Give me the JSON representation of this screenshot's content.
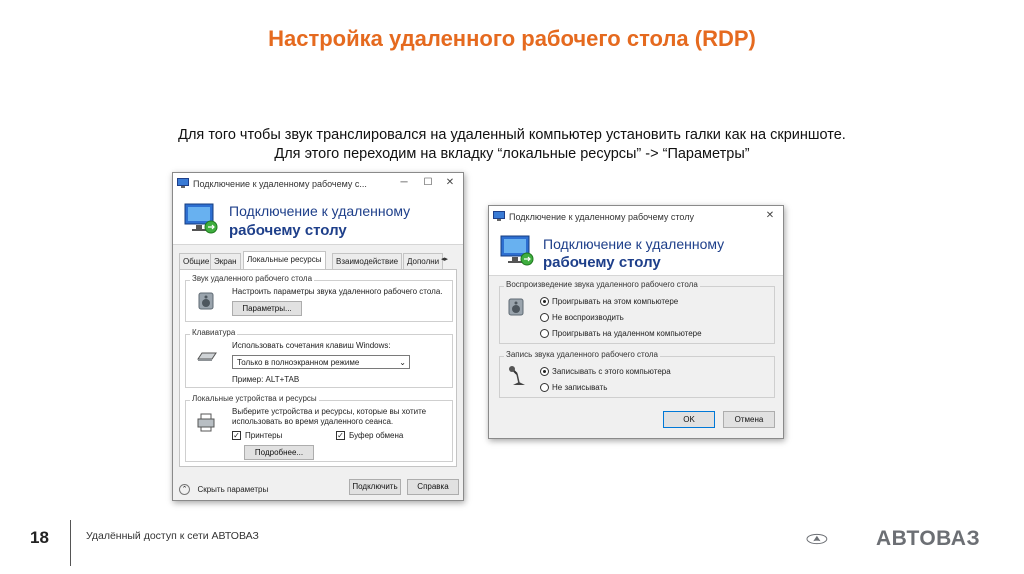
{
  "slide": {
    "title": "Настройка удаленного рабочего стола (RDP)",
    "description_line1": "Для того чтобы звук транслировался на удаленный компьютер установить галки как на скриншоте.",
    "description_line2": "Для этого переходим на вкладку “локальные ресурсы” -> “Параметры”"
  },
  "left_window": {
    "title": "Подключение к удаленному рабочему с...",
    "header_line1": "Подключение к удаленному",
    "header_line2": "рабочему столу",
    "tabs": [
      "Общие",
      "Экран",
      "Локальные ресурсы",
      "Взаимодействие",
      "Дополни"
    ],
    "active_tab": "Локальные ресурсы",
    "audio_group": {
      "title": "Звук удаленного рабочего стола",
      "text": "Настроить параметры звука удаленного рабочего стола.",
      "button": "Параметры..."
    },
    "keyboard_group": {
      "title": "Клавиатура",
      "text": "Использовать сочетания клавиш Windows:",
      "select_value": "Только в полноэкранном режиме",
      "example": "Пример: ALT+TAB"
    },
    "devices_group": {
      "title": "Локальные устройства и ресурсы",
      "text_line1": "Выберите устройства и ресурсы, которые вы хотите",
      "text_line2": "использовать во время удаленного сеанса.",
      "printers_label": "Принтеры",
      "printers_checked": true,
      "clipboard_label": "Буфер обмена",
      "clipboard_checked": true,
      "more_button": "Подробнее..."
    },
    "hide_options": "Скрыть параметры",
    "connect_button": "Подключить",
    "help_button": "Справка"
  },
  "right_window": {
    "title": "Подключение к удаленному рабочему столу",
    "header_line1": "Подключение к удаленному",
    "header_line2": "рабочему столу",
    "playback_group": {
      "title": "Воспроизведение звука удаленного рабочего стола",
      "options": [
        "Проигрывать на этом компьютере",
        "Не воспроизводить",
        "Проигрывать на удаленном компьютере"
      ],
      "selected_index": 0
    },
    "record_group": {
      "title": "Запись звука удаленного рабочего стола",
      "options": [
        "Записывать с этого компьютера",
        "Не записывать"
      ],
      "selected_index": 0
    },
    "ok_button": "OK",
    "cancel_button": "Отмена"
  },
  "footer": {
    "page_number": "18",
    "text": "Удалённый доступ к сети АВТОВАЗ",
    "brand": "АВТОВАЗ"
  },
  "colors": {
    "title_orange": "#e56a1f",
    "rdp_blue": "#1e3f8a",
    "brand_gray": "#6c6f74"
  }
}
